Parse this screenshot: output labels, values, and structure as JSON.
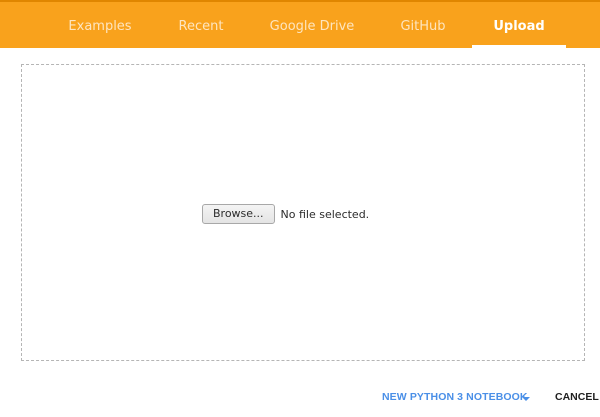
{
  "colors": {
    "tabbar_bg": "#f9a21c",
    "accent_link": "#4a8fe7",
    "border_dashed": "#b5b5b5"
  },
  "tabs": [
    {
      "label": "Examples",
      "active": false
    },
    {
      "label": "Recent",
      "active": false
    },
    {
      "label": "Google Drive",
      "active": false
    },
    {
      "label": "GitHub",
      "active": false
    },
    {
      "label": "Upload",
      "active": true
    }
  ],
  "upload": {
    "browse_label": "Browse...",
    "file_status": "No file selected."
  },
  "footer": {
    "new_notebook_label": "NEW PYTHON 3 NOTEBOOK",
    "cancel_label": "CANCEL",
    "dropdown_icon": "caret-down-icon"
  }
}
